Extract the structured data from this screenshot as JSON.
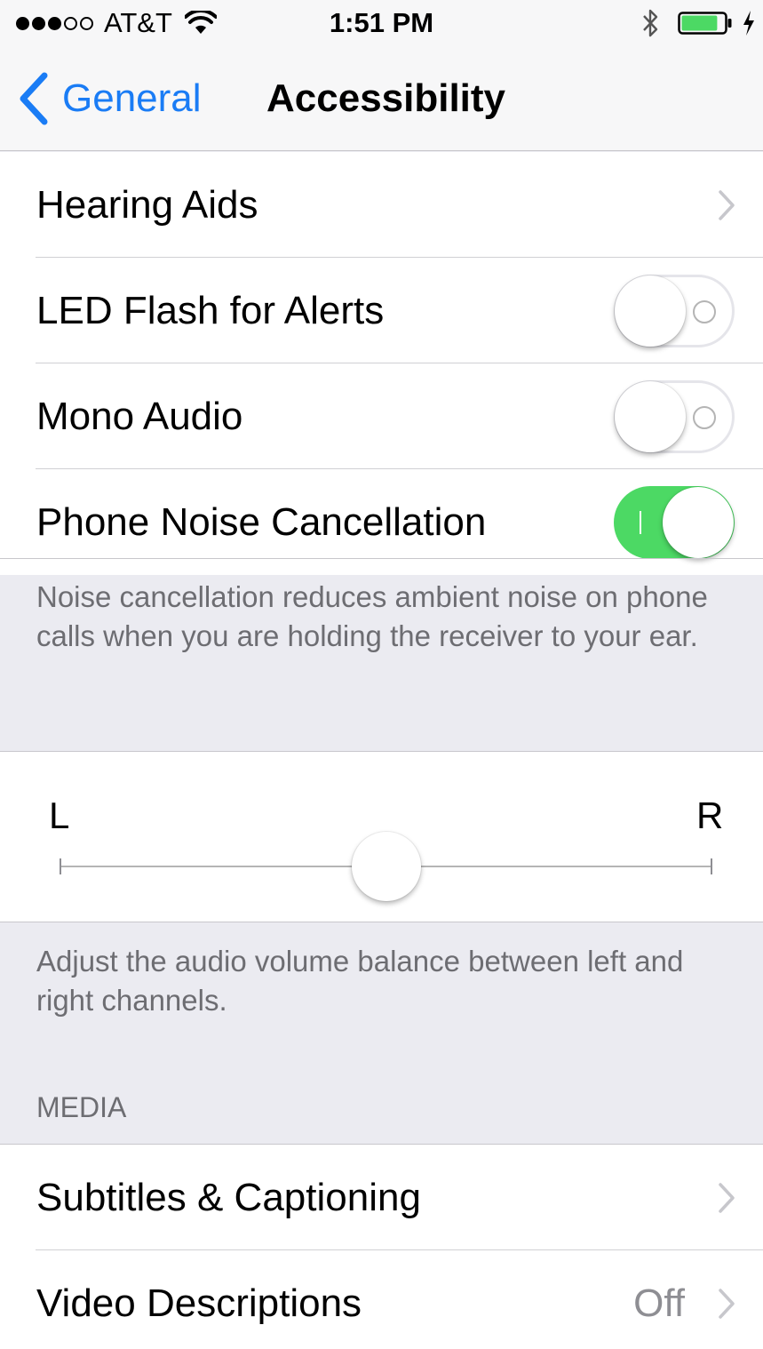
{
  "status_bar": {
    "signal_bars_filled": 3,
    "signal_bars_total": 5,
    "carrier": "AT&T",
    "time": "1:51 PM",
    "battery_level": 0.85,
    "charging": true,
    "bluetooth": true
  },
  "nav": {
    "back_label": "General",
    "title": "Accessibility"
  },
  "hearing_group": {
    "hearing_aids": "Hearing Aids",
    "led_flash": {
      "label": "LED Flash for Alerts",
      "on": false
    },
    "mono_audio": {
      "label": "Mono Audio",
      "on": false
    },
    "noise_cancellation": {
      "label": "Phone Noise Cancellation",
      "on": true
    },
    "footer": "Noise cancellation reduces ambient noise on phone calls when you are holding the receiver to your ear."
  },
  "balance": {
    "left_label": "L",
    "right_label": "R",
    "value": 0.5,
    "footer": "Adjust the audio volume balance between left and right channels."
  },
  "media": {
    "header": "MEDIA",
    "subtitles": "Subtitles & Captioning",
    "video_descriptions": {
      "label": "Video Descriptions",
      "value": "Off"
    }
  },
  "colors": {
    "tint": "#1a7cf5",
    "toggle_on": "#4cd964",
    "group_background": "#ebebf1",
    "secondary_text": "#6d6d72"
  },
  "icons": [
    "signal-dots",
    "wifi-icon",
    "bluetooth-icon",
    "battery-icon",
    "charging-bolt-icon",
    "back-chevron-icon",
    "disclosure-chevron-icon"
  ]
}
